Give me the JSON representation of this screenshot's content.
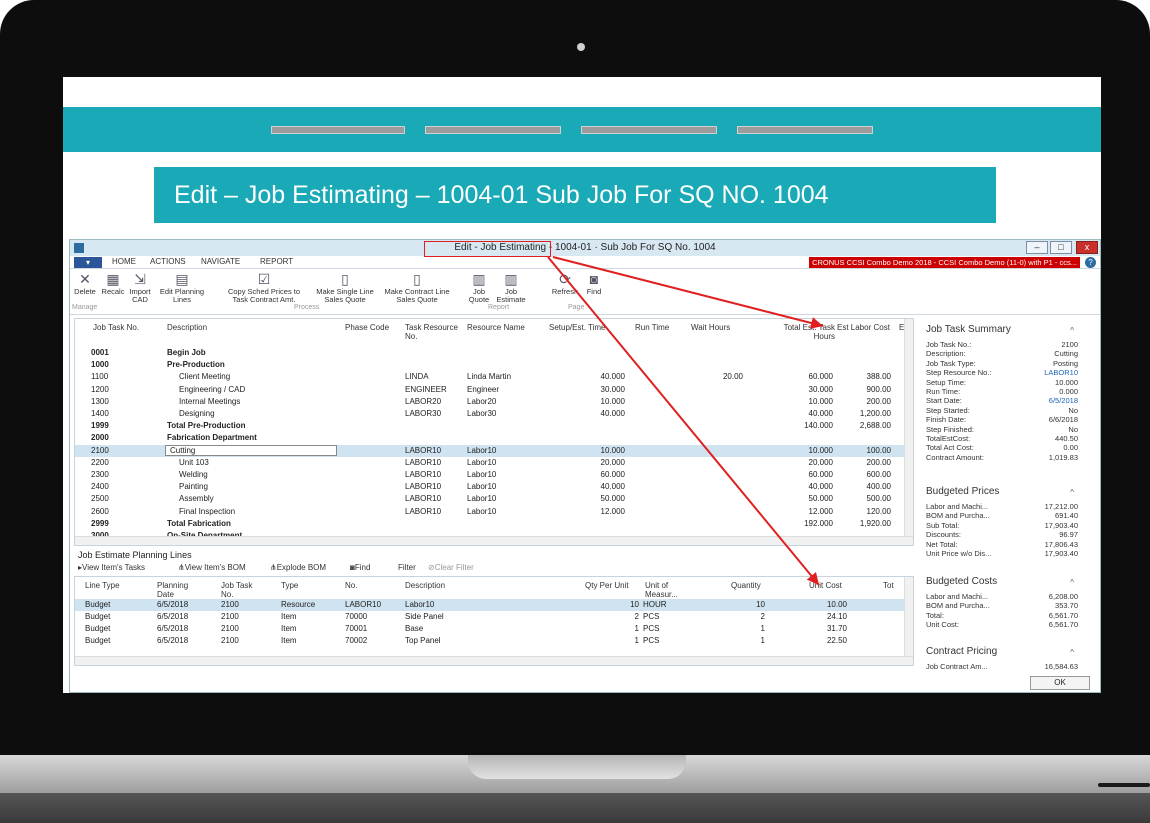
{
  "slide": {
    "title": "Edit – Job Estimating – 1004-01 Sub Job For SQ NO. 1004"
  },
  "window": {
    "title": "Edit - Job Estimating - 1004-01 · Sub Job For SQ No. 1004",
    "company": "CRONUS CCSI Combo Demo 2018 - CCSI Combo Demo (11-0) with P1 - ccs...",
    "tabs": [
      "HOME",
      "ACTIONS",
      "NAVIGATE",
      "REPORT"
    ],
    "minimize": "–",
    "maximize": "□",
    "close": "x",
    "help": "?"
  },
  "ribbon": {
    "delete": "Delete",
    "recalc": "Recalc",
    "import_cad": "Import CAD",
    "edit_planning": "Edit Planning Lines",
    "copy_sched": "Copy Sched Prices to Task Contract Amt.",
    "make_single": "Make Single Line Sales Quote",
    "make_contract": "Make Contract Line Sales Quote",
    "job_quote": "Job Quote",
    "job_estimate": "Job Estimate",
    "refresh": "Refresh",
    "find": "Find",
    "group_manage": "Manage",
    "group_process": "Process",
    "group_report": "Report",
    "group_page": "Page"
  },
  "main_grid": {
    "headers": {
      "job_task_no": "Job Task No.",
      "description": "Description",
      "phase_code": "Phase Code",
      "task_resource": "Task Resource No.",
      "resource_name": "Resource Name",
      "setup": "Setup/Est. Time",
      "run_time": "Run Time",
      "wait_hours": "Wait Hours",
      "total_est": "Total Est. Task Hours",
      "est_labor": "Est Labor Cost",
      "extra": "E"
    },
    "rows": [
      {
        "no": "0001",
        "desc": "Begin Job",
        "res": "",
        "name": "",
        "setup": "",
        "wait": "",
        "total": "",
        "labor": ""
      },
      {
        "no": "1000",
        "desc": "Pre-Production",
        "res": "",
        "name": "",
        "setup": "",
        "wait": "",
        "total": "",
        "labor": ""
      },
      {
        "no": "1100",
        "desc": "Client Meeting",
        "res": "LINDA",
        "name": "Linda Martin",
        "setup": "40.000",
        "wait": "20.00",
        "total": "60.000",
        "labor": "388.00"
      },
      {
        "no": "1200",
        "desc": "Engineering / CAD",
        "res": "ENGINEER",
        "name": "Engineer",
        "setup": "30.000",
        "wait": "",
        "total": "30.000",
        "labor": "900.00"
      },
      {
        "no": "1300",
        "desc": "Internal Meetings",
        "res": "LABOR20",
        "name": "Labor20",
        "setup": "10.000",
        "wait": "",
        "total": "10.000",
        "labor": "200.00"
      },
      {
        "no": "1400",
        "desc": "Designing",
        "res": "LABOR30",
        "name": "Labor30",
        "setup": "40.000",
        "wait": "",
        "total": "40.000",
        "labor": "1,200.00"
      },
      {
        "no": "1999",
        "desc": "Total Pre-Production",
        "res": "",
        "name": "",
        "setup": "",
        "wait": "",
        "total": "140.000",
        "labor": "2,688.00"
      },
      {
        "no": "2000",
        "desc": "Fabrication Department",
        "res": "",
        "name": "",
        "setup": "",
        "wait": "",
        "total": "",
        "labor": ""
      },
      {
        "no": "2100",
        "desc": "Cutting",
        "res": "LABOR10",
        "name": "Labor10",
        "setup": "10.000",
        "wait": "",
        "total": "10.000",
        "labor": "100.00"
      },
      {
        "no": "2200",
        "desc": "Unit 103",
        "res": "LABOR10",
        "name": "Labor10",
        "setup": "20.000",
        "wait": "",
        "total": "20.000",
        "labor": "200.00"
      },
      {
        "no": "2300",
        "desc": "Welding",
        "res": "LABOR10",
        "name": "Labor10",
        "setup": "60.000",
        "wait": "",
        "total": "60.000",
        "labor": "600.00"
      },
      {
        "no": "2400",
        "desc": "Painting",
        "res": "LABOR10",
        "name": "Labor10",
        "setup": "40.000",
        "wait": "",
        "total": "40.000",
        "labor": "400.00"
      },
      {
        "no": "2500",
        "desc": "Assembly",
        "res": "LABOR10",
        "name": "Labor10",
        "setup": "50.000",
        "wait": "",
        "total": "50.000",
        "labor": "500.00"
      },
      {
        "no": "2600",
        "desc": "Final Inspection",
        "res": "LABOR10",
        "name": "Labor10",
        "setup": "12.000",
        "wait": "",
        "total": "12.000",
        "labor": "120.00"
      },
      {
        "no": "2999",
        "desc": "Total Fabrication",
        "res": "",
        "name": "",
        "setup": "",
        "wait": "",
        "total": "192.000",
        "labor": "1,920.00"
      },
      {
        "no": "3000",
        "desc": "On-Site Department",
        "res": "",
        "name": "",
        "setup": "",
        "wait": "",
        "total": "",
        "labor": ""
      }
    ]
  },
  "planning": {
    "title": "Job Estimate Planning Lines",
    "toolbar": {
      "view_tasks": "View Item's Tasks",
      "view_bom": "View Item's BOM",
      "explode_bom": "Explode BOM",
      "find": "Find",
      "filter": "Filter",
      "clear_filter": "Clear Filter"
    },
    "headers": {
      "line_type": "Line Type",
      "planning_date": "Planning Date",
      "job_task": "Job Task No.",
      "type": "Type",
      "no": "No.",
      "description": "Description",
      "qty_per_unit": "Qty Per Unit",
      "unit_of_measure": "Unit of Measur...",
      "quantity": "Quantity",
      "unit_cost": "Unit Cost",
      "tot": "Tot"
    },
    "rows": [
      {
        "line": "Budget",
        "date": "6/5/2018",
        "task": "2100",
        "type": "Resource",
        "no": "LABOR10",
        "desc": "Labor10",
        "qpu": "10",
        "uom": "HOUR",
        "qty": "10",
        "cost": "10.00"
      },
      {
        "line": "Budget",
        "date": "6/5/2018",
        "task": "2100",
        "type": "Item",
        "no": "70000",
        "desc": "Side Panel",
        "qpu": "2",
        "uom": "PCS",
        "qty": "2",
        "cost": "24.10"
      },
      {
        "line": "Budget",
        "date": "6/5/2018",
        "task": "2100",
        "type": "Item",
        "no": "70001",
        "desc": "Base",
        "qpu": "1",
        "uom": "PCS",
        "qty": "1",
        "cost": "31.70"
      },
      {
        "line": "Budget",
        "date": "6/5/2018",
        "task": "2100",
        "type": "Item",
        "no": "70002",
        "desc": "Top Panel",
        "qpu": "1",
        "uom": "PCS",
        "qty": "1",
        "cost": "22.50"
      }
    ]
  },
  "factbox": {
    "summary_title": "Job Task Summary",
    "summary": [
      {
        "k": "Job Task No.:",
        "v": "2100"
      },
      {
        "k": "Description:",
        "v": "Cutting"
      },
      {
        "k": "Job Task Type:",
        "v": "Posting"
      },
      {
        "k": "Step Resource No.:",
        "v": "LABOR10"
      },
      {
        "k": "Setup Time:",
        "v": "10.000"
      },
      {
        "k": "Run Time:",
        "v": "0.000"
      },
      {
        "k": "Start Date:",
        "v": "6/5/2018"
      },
      {
        "k": "Step Started:",
        "v": "No"
      },
      {
        "k": "Finish Date:",
        "v": "6/6/2018"
      },
      {
        "k": "Step Finished:",
        "v": "No"
      },
      {
        "k": "TotalEstCost:",
        "v": "440.50"
      },
      {
        "k": "Total Act Cost:",
        "v": "0.00"
      },
      {
        "k": "Contract Amount:",
        "v": "1,019.83"
      }
    ],
    "prices_title": "Budgeted Prices",
    "prices": [
      {
        "k": "Labor and Machi...",
        "v": "17,212.00"
      },
      {
        "k": "BOM and Purcha...",
        "v": "691.40"
      },
      {
        "k": "Sub Total:",
        "v": "17,903.40"
      },
      {
        "k": "Discounts:",
        "v": "96.97"
      },
      {
        "k": "Net Total:",
        "v": "17,806.43"
      },
      {
        "k": "Unit Price w/o Dis...",
        "v": "17,903.40"
      }
    ],
    "costs_title": "Budgeted Costs",
    "costs": [
      {
        "k": "Labor and Machi...",
        "v": "6,208.00"
      },
      {
        "k": "BOM and Purcha...",
        "v": "353.70"
      },
      {
        "k": "Total:",
        "v": "6,561.70"
      },
      {
        "k": "Unit Cost:",
        "v": "6,561.70"
      }
    ],
    "pricing_title": "Contract Pricing",
    "pricing": [
      {
        "k": "Job Contract Am...",
        "v": "16,584.63"
      }
    ],
    "ok": "OK"
  },
  "colors": {
    "teal": "#1aa9b7",
    "selection": "#cfe3f1",
    "annotation_red": "#e02020",
    "company_red": "#cc0000"
  }
}
